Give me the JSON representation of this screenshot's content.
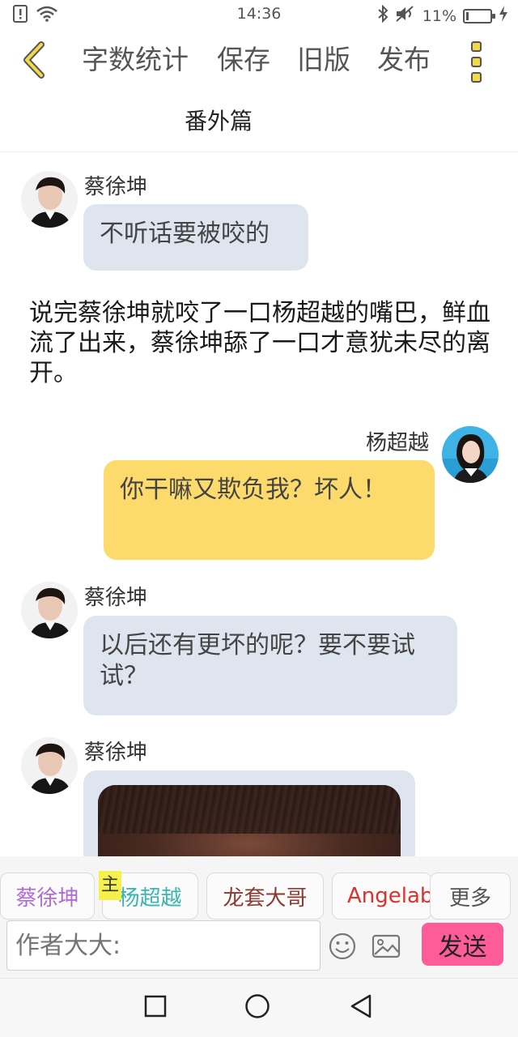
{
  "status_bar": {
    "time": "14:36",
    "battery_percent": "11%",
    "battery_level": 0.11
  },
  "toolbar": {
    "word_count_label": "字数统计",
    "save_label": "保存",
    "old_version_label": "旧版",
    "publish_label": "发布"
  },
  "chapter": {
    "title": "番外篇"
  },
  "messages": [
    {
      "sender": "蔡徐坤",
      "text": "不听话要被咬的"
    },
    {
      "narration": "说完蔡徐坤就咬了一口杨超越的嘴巴，鲜血流了出来，蔡徐坤舔了一口才意犹未尽的离开。"
    },
    {
      "sender": "杨超越",
      "text": "你干嘛又欺负我？坏人！"
    },
    {
      "sender": "蔡徐坤",
      "text": "以后还有更坏的呢？要不要试试？"
    },
    {
      "sender": "蔡徐坤",
      "type": "image"
    }
  ],
  "characters": {
    "items": [
      "蔡徐坤",
      "杨超越",
      "龙套大哥",
      "Angelaba"
    ],
    "main_badge": "主",
    "more_label": "更多"
  },
  "compose": {
    "placeholder": "作者大大:",
    "send_label": "发送"
  },
  "colors": {
    "accent_yellow": "#f3d94a",
    "send_pink": "#fd5c98",
    "bubble_gray": "#dfe5ee",
    "bubble_yellow": "#fcdb6c"
  }
}
